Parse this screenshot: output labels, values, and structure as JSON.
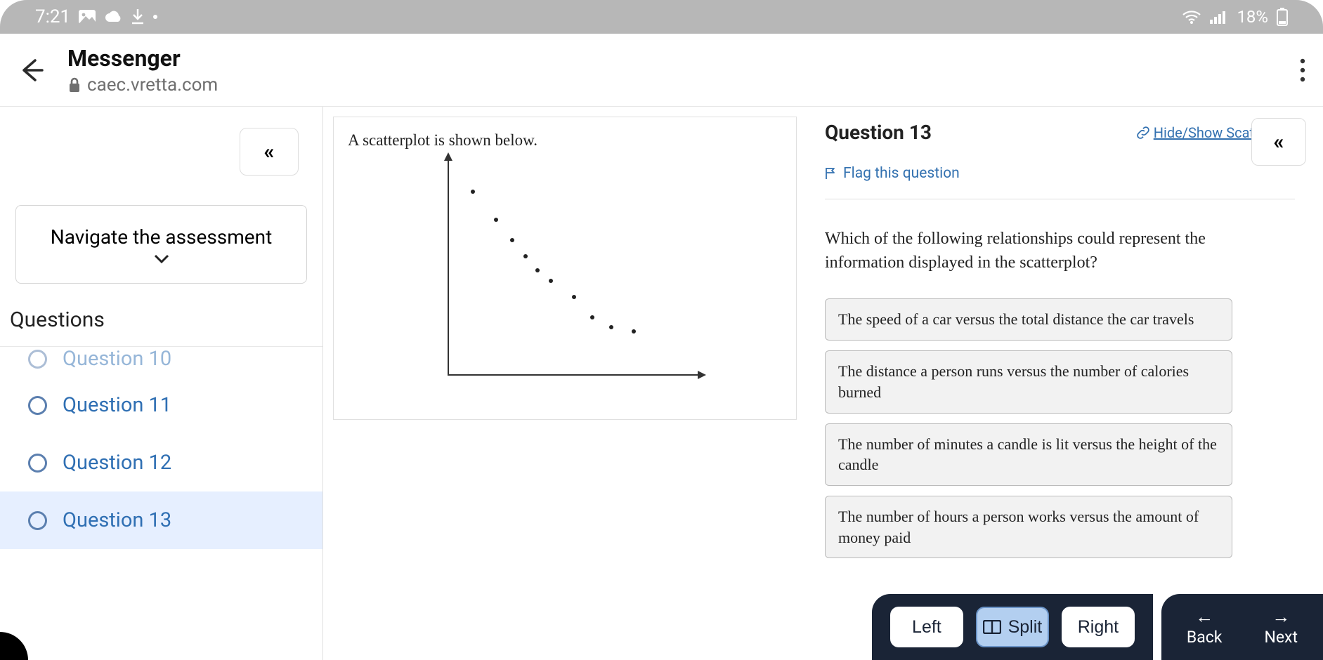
{
  "status_bar": {
    "time": "7:21",
    "battery": "18%"
  },
  "browser": {
    "title": "Messenger",
    "url": "caec.vretta.com"
  },
  "sidebar": {
    "collapse_glyph": "«",
    "nav_label": "Navigate the assessment",
    "questions_header": "Questions",
    "items": [
      {
        "label": "Question 10",
        "active": false,
        "partial": true
      },
      {
        "label": "Question 11",
        "active": false,
        "partial": false
      },
      {
        "label": "Question 12",
        "active": false,
        "partial": false
      },
      {
        "label": "Question 13",
        "active": true,
        "partial": false
      }
    ]
  },
  "scatter": {
    "caption": "A scatterplot is shown below."
  },
  "question": {
    "title": "Question 13",
    "hide_show": "Hide/Show Scatterplot",
    "flag": "Flag this question",
    "prompt": "Which of the following relationships could represent the information displayed in the scatterplot?",
    "answers": [
      "The speed of a car versus the total distance the car travels",
      "The distance a person runs versus the number of calories burned",
      "The number of minutes a candle is lit versus the height of the candle",
      "The number of hours a person works versus the amount of money paid"
    ]
  },
  "bottom": {
    "left": "Left",
    "split": "Split",
    "right": "Right",
    "back": "Back",
    "next": "Next"
  },
  "chart_data": {
    "type": "scatter",
    "title": "",
    "xlabel": "",
    "ylabel": "",
    "xlim": [
      0,
      10
    ],
    "ylim": [
      0,
      10
    ],
    "points": [
      {
        "x": 1.0,
        "y": 9.2
      },
      {
        "x": 2.0,
        "y": 7.8
      },
      {
        "x": 2.7,
        "y": 6.8
      },
      {
        "x": 3.3,
        "y": 6.0
      },
      {
        "x": 3.8,
        "y": 5.3
      },
      {
        "x": 4.4,
        "y": 4.8
      },
      {
        "x": 5.4,
        "y": 4.0
      },
      {
        "x": 6.2,
        "y": 3.0
      },
      {
        "x": 7.0,
        "y": 2.5
      },
      {
        "x": 8.0,
        "y": 2.3
      }
    ]
  }
}
